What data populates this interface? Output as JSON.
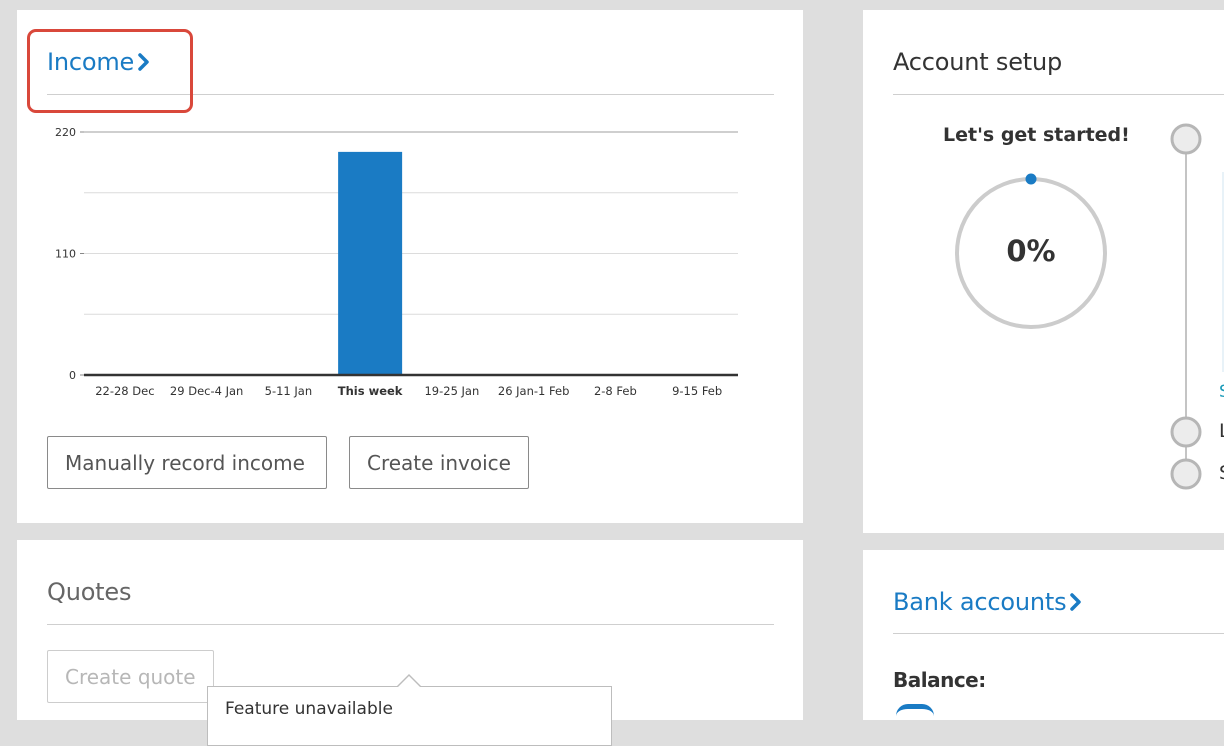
{
  "income": {
    "title": "Income",
    "manual_button": "Manually record income",
    "invoice_button": "Create invoice"
  },
  "chart_data": {
    "type": "bar",
    "categories": [
      "22-28 Dec",
      "29 Dec-4 Jan",
      "5-11 Jan",
      "This week",
      "19-25 Jan",
      "26 Jan-1 Feb",
      "2-8 Feb",
      "9-15 Feb"
    ],
    "values": [
      0,
      0,
      0,
      202,
      0,
      0,
      0,
      0
    ],
    "highlighted_category": "This week",
    "yticks": [
      "0",
      "110",
      "220"
    ],
    "ylim": [
      0,
      220
    ],
    "grid": true,
    "bar_color": "#1a7bc4"
  },
  "quotes": {
    "title": "Quotes",
    "create_button": "Create quote",
    "tooltip_text": "Feature unavailable"
  },
  "account_setup": {
    "title": "Account setup",
    "started_label": "Let's get started!",
    "progress_text": "0%",
    "progress_value": 0,
    "step_partial_labels": [
      "L",
      "S"
    ],
    "link_partial": "S"
  },
  "bank_accounts": {
    "title": "Bank accounts",
    "balance_label": "Balance:"
  },
  "colors": {
    "accent": "#1a7bc4",
    "highlight": "#d9483b",
    "background": "#dedede"
  }
}
